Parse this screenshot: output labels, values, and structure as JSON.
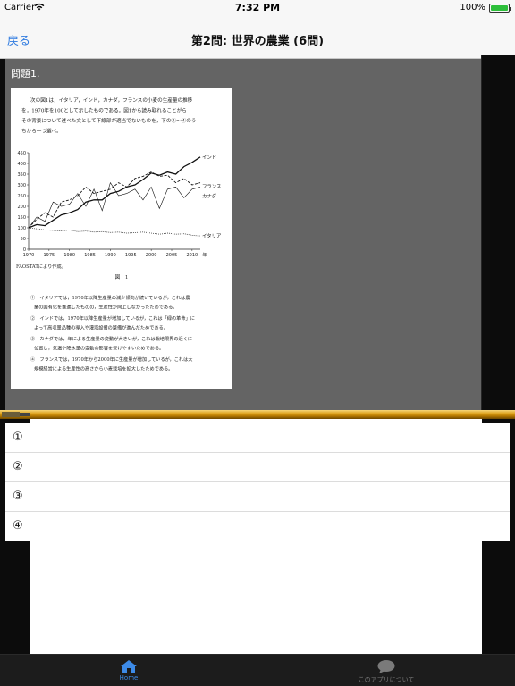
{
  "status_bar": {
    "carrier": "Carrier",
    "time": "7:32 PM",
    "battery": "100%",
    "battery_level": 1.0
  },
  "nav": {
    "back_label": "戻る",
    "title": "第2問: 世界の農業 (6問)"
  },
  "question": {
    "label": "問題1.",
    "prompt": [
      "次の図1は，イタリア，インド，カナダ，フランスの小麦の生産量の推移",
      "を，1970年を100として示したものである。図1から読み取れることがら",
      "その背景について述べた文として下線部が適当でないものを，下の①～④のう",
      "ちから一つ選べ。"
    ],
    "source_note": "FAOSTATにより作成。",
    "figure_caption": "図　1",
    "options": [
      [
        "①　イタリアでは，1970年以降生産量の減少傾向が続いているが，これは農",
        "業の国有化を推進したものの，生産性が向上しなかったためである。"
      ],
      [
        "②　インドでは，1970年以降生産量が増加しているが，これは「緑の革命」に",
        "よって高収量品種の導入や灌漑設備の整備が進んだためである。"
      ],
      [
        "③　カナダでは，年による生産量の変動が大きいが，これは栽培限界の近くに",
        "位置し，気温や降水量の変動の影響を受けやすいためである。"
      ],
      [
        "④　フランスでは，1970年から2000年に生産量が増加しているが，これは大",
        "規模経営による生産性の高さから小麦栽培を拡大したためである。"
      ]
    ]
  },
  "chart_data": {
    "type": "line",
    "x": [
      1970,
      1972,
      1974,
      1976,
      1978,
      1980,
      1982,
      1984,
      1986,
      1988,
      1990,
      1992,
      1994,
      1996,
      1998,
      2000,
      2002,
      2004,
      2006,
      2008,
      2010,
      2012
    ],
    "xticks": [
      "1970",
      "1975",
      "1980",
      "1985",
      "1990",
      "1995",
      "2000",
      "2005",
      "2010",
      "年"
    ],
    "ylim": [
      0,
      450
    ],
    "yticks": [
      "0",
      "50",
      "100",
      "150",
      "200",
      "250",
      "300",
      "350",
      "400",
      "450"
    ],
    "series": [
      {
        "name": "インド",
        "style": "solid-bold",
        "values": [
          100,
          115,
          110,
          135,
          160,
          170,
          185,
          220,
          230,
          230,
          260,
          270,
          290,
          300,
          325,
          355,
          345,
          360,
          350,
          385,
          405,
          430
        ]
      },
      {
        "name": "フランス",
        "style": "dashed",
        "values": [
          100,
          140,
          170,
          150,
          220,
          230,
          250,
          290,
          260,
          270,
          280,
          310,
          290,
          330,
          340,
          360,
          340,
          345,
          310,
          330,
          300,
          310
        ]
      },
      {
        "name": "カナダ",
        "style": "solid-thin",
        "values": [
          100,
          150,
          130,
          220,
          200,
          210,
          260,
          200,
          280,
          180,
          310,
          250,
          260,
          280,
          230,
          290,
          190,
          280,
          290,
          240,
          280,
          290
        ]
      },
      {
        "name": "イタリア",
        "style": "dotted",
        "values": [
          100,
          95,
          90,
          88,
          85,
          90,
          82,
          85,
          80,
          82,
          78,
          80,
          75,
          77,
          80,
          75,
          70,
          75,
          70,
          72,
          65,
          62
        ]
      }
    ],
    "grid": false,
    "legend": "inline-right"
  },
  "answers": [
    "①",
    "②",
    "③",
    "④"
  ],
  "tabs": {
    "home": "Home",
    "about": "このアプリについて"
  },
  "colors": {
    "accent": "#2f7be0",
    "tab_active": "#3d8be8",
    "divider": "#d99a10"
  }
}
